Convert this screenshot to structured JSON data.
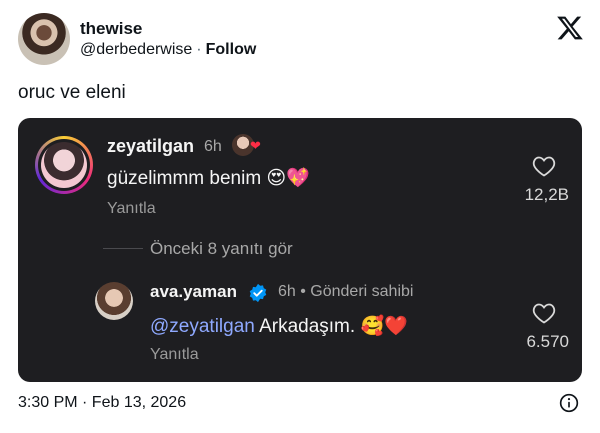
{
  "header": {
    "display_name": "thewise",
    "handle": "@derbederwise",
    "separator": "·",
    "follow_label": "Follow",
    "logo_icon": "x-logo-icon"
  },
  "tweet": {
    "text": "oruc ve eleni"
  },
  "embed": {
    "comment1": {
      "username": "zeyatilgan",
      "time": "6h",
      "text": "güzelimmm benim 😍💖",
      "reply_label": "Yanıtla",
      "likes": "12,2B"
    },
    "more_replies": "Önceki 8 yanıtı gör",
    "comment2": {
      "username": "ava.yaman",
      "time": "6h • Gönderi sahibi",
      "mention": "@zeyatilgan",
      "text": " Arkadaşım. 🥰❤️",
      "reply_label": "Yanıtla",
      "likes": "6.570"
    }
  },
  "footer": {
    "timestamp": "3:30 PM · Feb 13, 2026",
    "info_icon": "info-icon"
  },
  "colors": {
    "card_bg": "#1e1e21",
    "mention": "#8fa9ff",
    "verified": "#0095f6"
  }
}
